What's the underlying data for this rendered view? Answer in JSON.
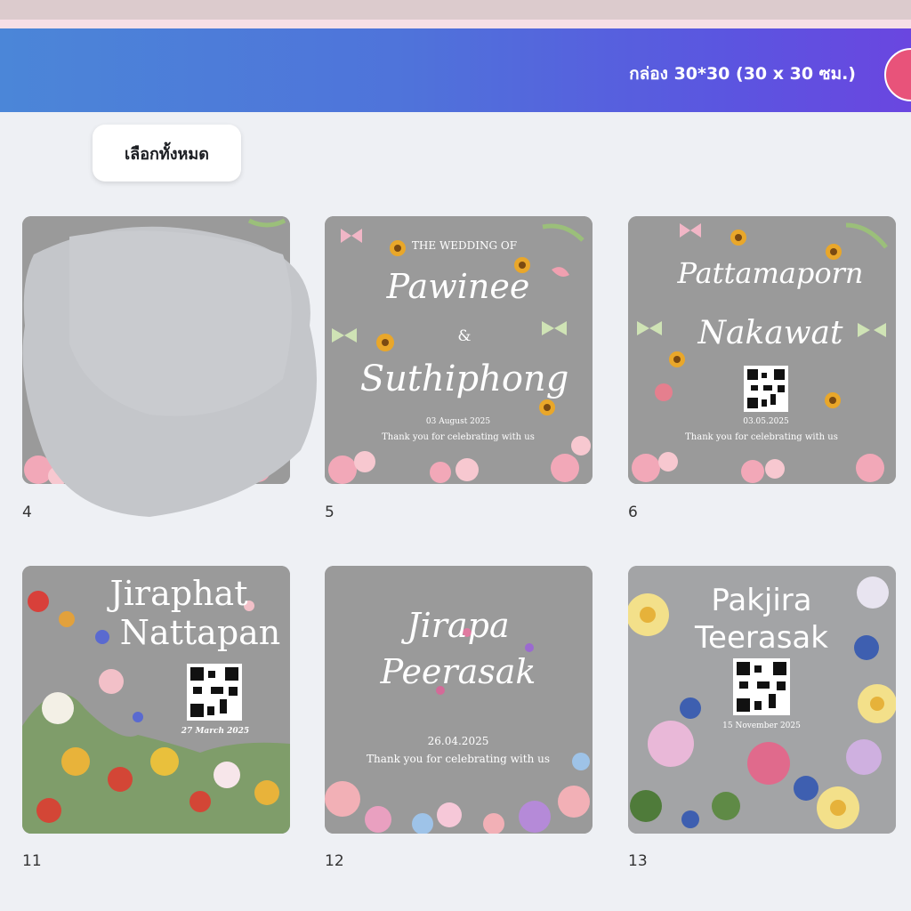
{
  "header": {
    "title": "กล่อง 30*30 (30 x 30 ซม.)"
  },
  "toolbar": {
    "select_all_label": "เลือกทั้งหมด"
  },
  "pages": [
    {
      "number": "4"
    },
    {
      "number": "5",
      "line1": "THE WEDDING OF",
      "name1": "Pawinee",
      "amp": "&",
      "name2": "Suthiphong",
      "date": "03 August 2025",
      "thanks": "Thank you for celebrating with us"
    },
    {
      "number": "6",
      "name1": "Pattamaporn",
      "name2": "Nakawat",
      "date": "03.05.2025",
      "thanks": "Thank you for celebrating with us"
    },
    {
      "number": "11",
      "name1": "Jiraphat",
      "name2": "Nattapan",
      "date": "27 March 2025"
    },
    {
      "number": "12",
      "name1": "Jirapa",
      "name2": "Peerasak",
      "date": "26.04.2025",
      "thanks": "Thank you for celebrating with us"
    },
    {
      "number": "13",
      "name1": "Pakjira",
      "name2": "Teerasak",
      "date": "15 November 2025"
    }
  ]
}
